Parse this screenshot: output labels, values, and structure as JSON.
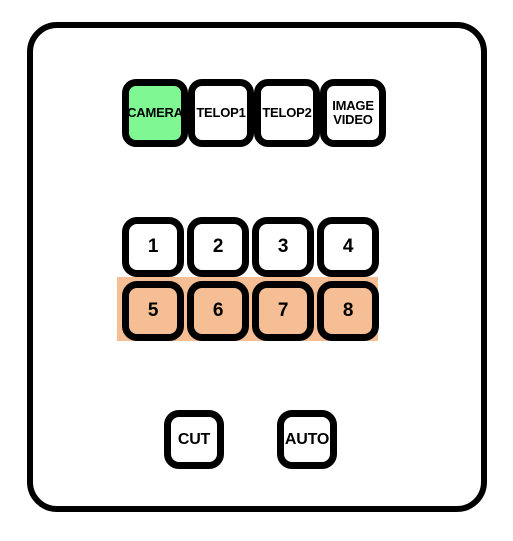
{
  "device": {
    "name": "video-switcher-control-panel",
    "background_color": "#ffffff",
    "outline_color": "#000000"
  },
  "colors": {
    "key_default_fill": "#ffffff",
    "key_active_green": "#7ff893",
    "key_active_peach": "#f5be95",
    "band_peach": "#f5be95",
    "outline": "#000000",
    "text": "#000000"
  },
  "source_row": {
    "name": "source-select-row",
    "keys": [
      {
        "label": "CAMERA",
        "lines": [
          "CAMERA"
        ],
        "state": "active",
        "fill": "#7ff893"
      },
      {
        "label": "TELOP1",
        "lines": [
          "TELOP1"
        ],
        "state": "inactive",
        "fill": "#ffffff"
      },
      {
        "label": "TELOP2",
        "lines": [
          "TELOP2"
        ],
        "state": "inactive",
        "fill": "#ffffff"
      },
      {
        "label": "IMAGE VIDEO",
        "lines": [
          "IMAGE",
          "VIDEO"
        ],
        "state": "inactive",
        "fill": "#ffffff"
      }
    ]
  },
  "bus_rows": {
    "name": "numeric-bus-rows",
    "upper": {
      "name": "bus-row-upper",
      "state": "inactive",
      "keys": [
        {
          "label": "1",
          "state": "inactive",
          "fill": "#ffffff"
        },
        {
          "label": "2",
          "state": "inactive",
          "fill": "#ffffff"
        },
        {
          "label": "3",
          "state": "inactive",
          "fill": "#ffffff"
        },
        {
          "label": "4",
          "state": "inactive",
          "fill": "#ffffff"
        }
      ]
    },
    "lower": {
      "name": "bus-row-lower",
      "state": "active",
      "band_fill": "#f5be95",
      "keys": [
        {
          "label": "5",
          "state": "active",
          "fill": "#f5be95"
        },
        {
          "label": "6",
          "state": "active",
          "fill": "#f5be95"
        },
        {
          "label": "7",
          "state": "active",
          "fill": "#f5be95"
        },
        {
          "label": "8",
          "state": "active",
          "fill": "#f5be95"
        }
      ]
    }
  },
  "transition_row": {
    "name": "transition-row",
    "keys": [
      {
        "label": "CUT",
        "state": "inactive",
        "fill": "#ffffff"
      },
      {
        "label": "AUTO",
        "state": "inactive",
        "fill": "#ffffff"
      }
    ]
  }
}
